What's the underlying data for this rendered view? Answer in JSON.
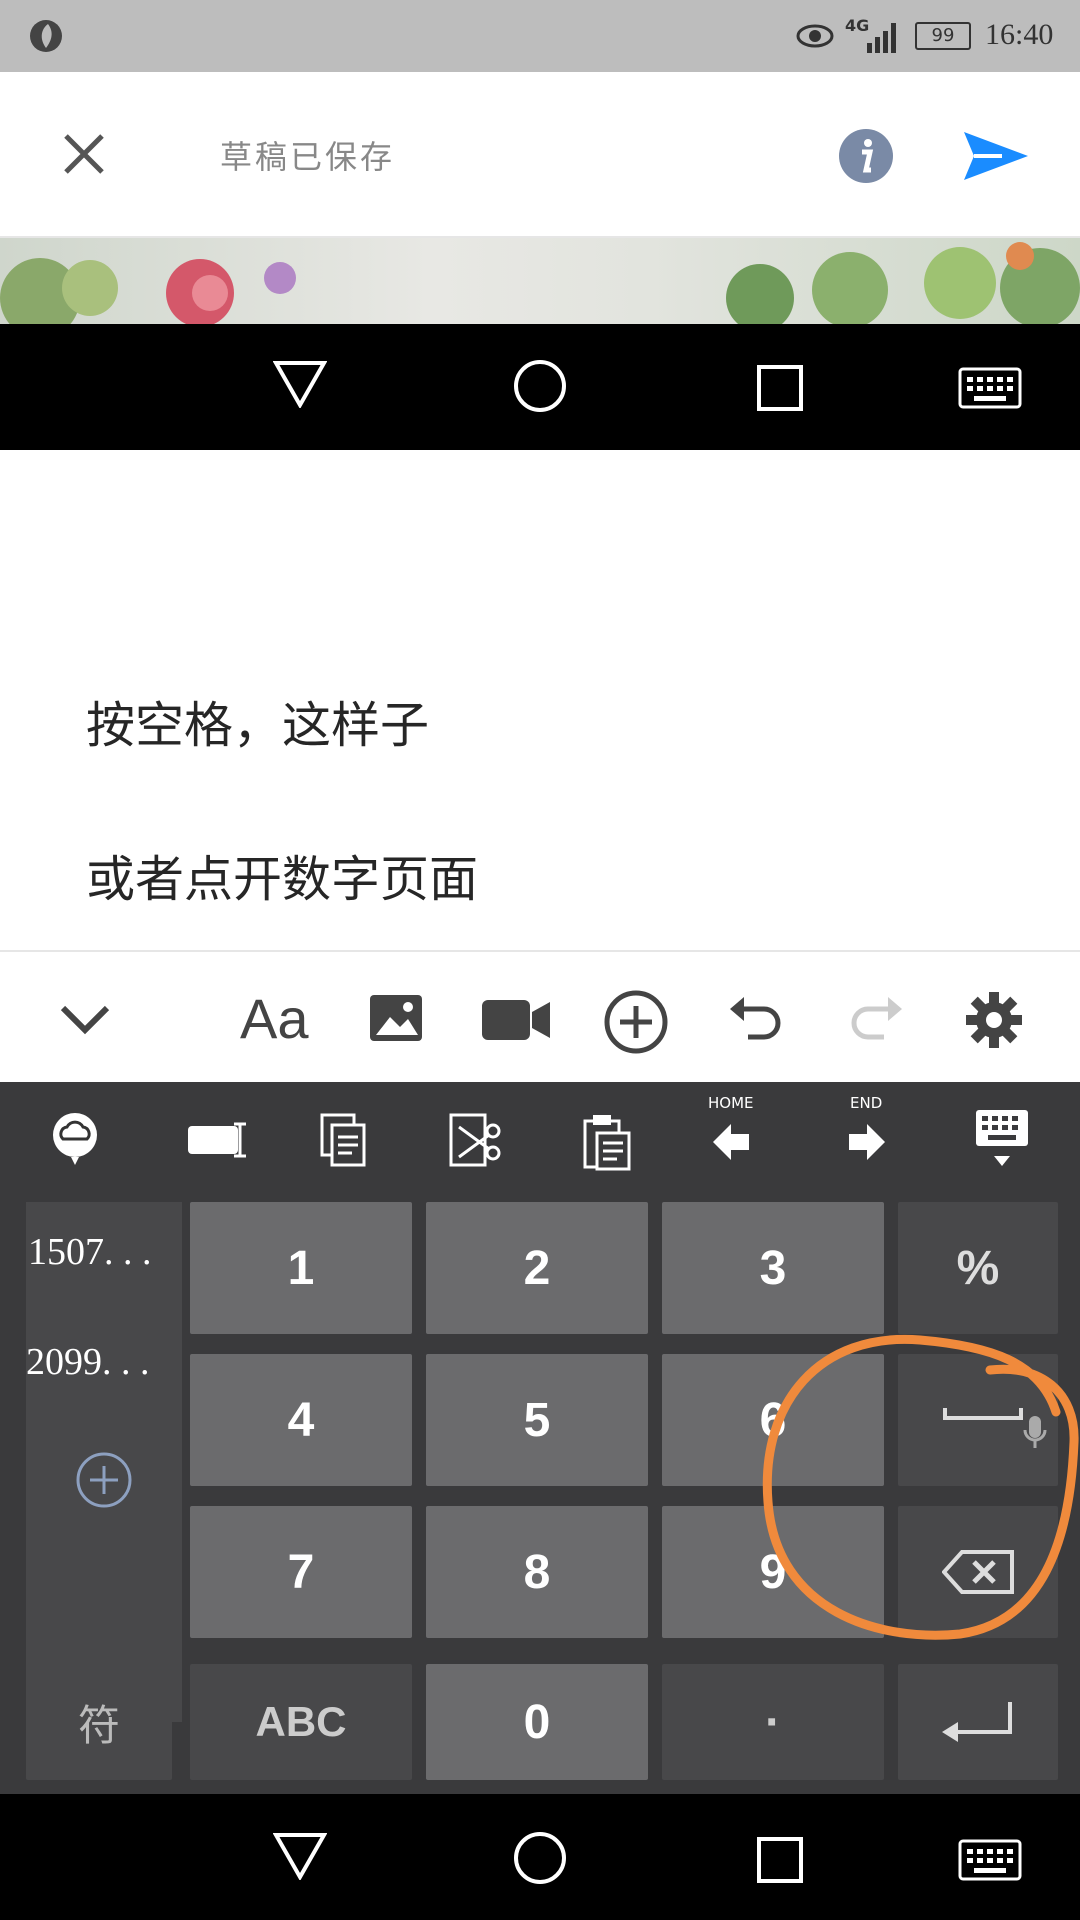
{
  "status_bar": {
    "time": "16:40",
    "network": "4G",
    "battery": "99"
  },
  "header": {
    "title": "草稿已保存"
  },
  "editor": {
    "lines": [
      "按空格，这样子",
      "或者点开数字页面"
    ]
  },
  "format_toolbar": {
    "font_label": "Aa"
  },
  "keyboard": {
    "toolbar": {
      "home_label": "HOME",
      "end_label": "END"
    },
    "candidates": [
      "1507. . .",
      "2099. . ."
    ],
    "keys": {
      "k1": "1",
      "k2": "2",
      "k3": "3",
      "percent": "%",
      "k4": "4",
      "k5": "5",
      "k6": "6",
      "k7": "7",
      "k8": "8",
      "k9": "9",
      "symbols": "符",
      "abc": "ABC",
      "k0": "0",
      "dot": "·"
    }
  },
  "colors": {
    "accent_send": "#1a8cff",
    "info_icon": "#7a8aa6",
    "annotation_circle": "#f08a3c"
  }
}
